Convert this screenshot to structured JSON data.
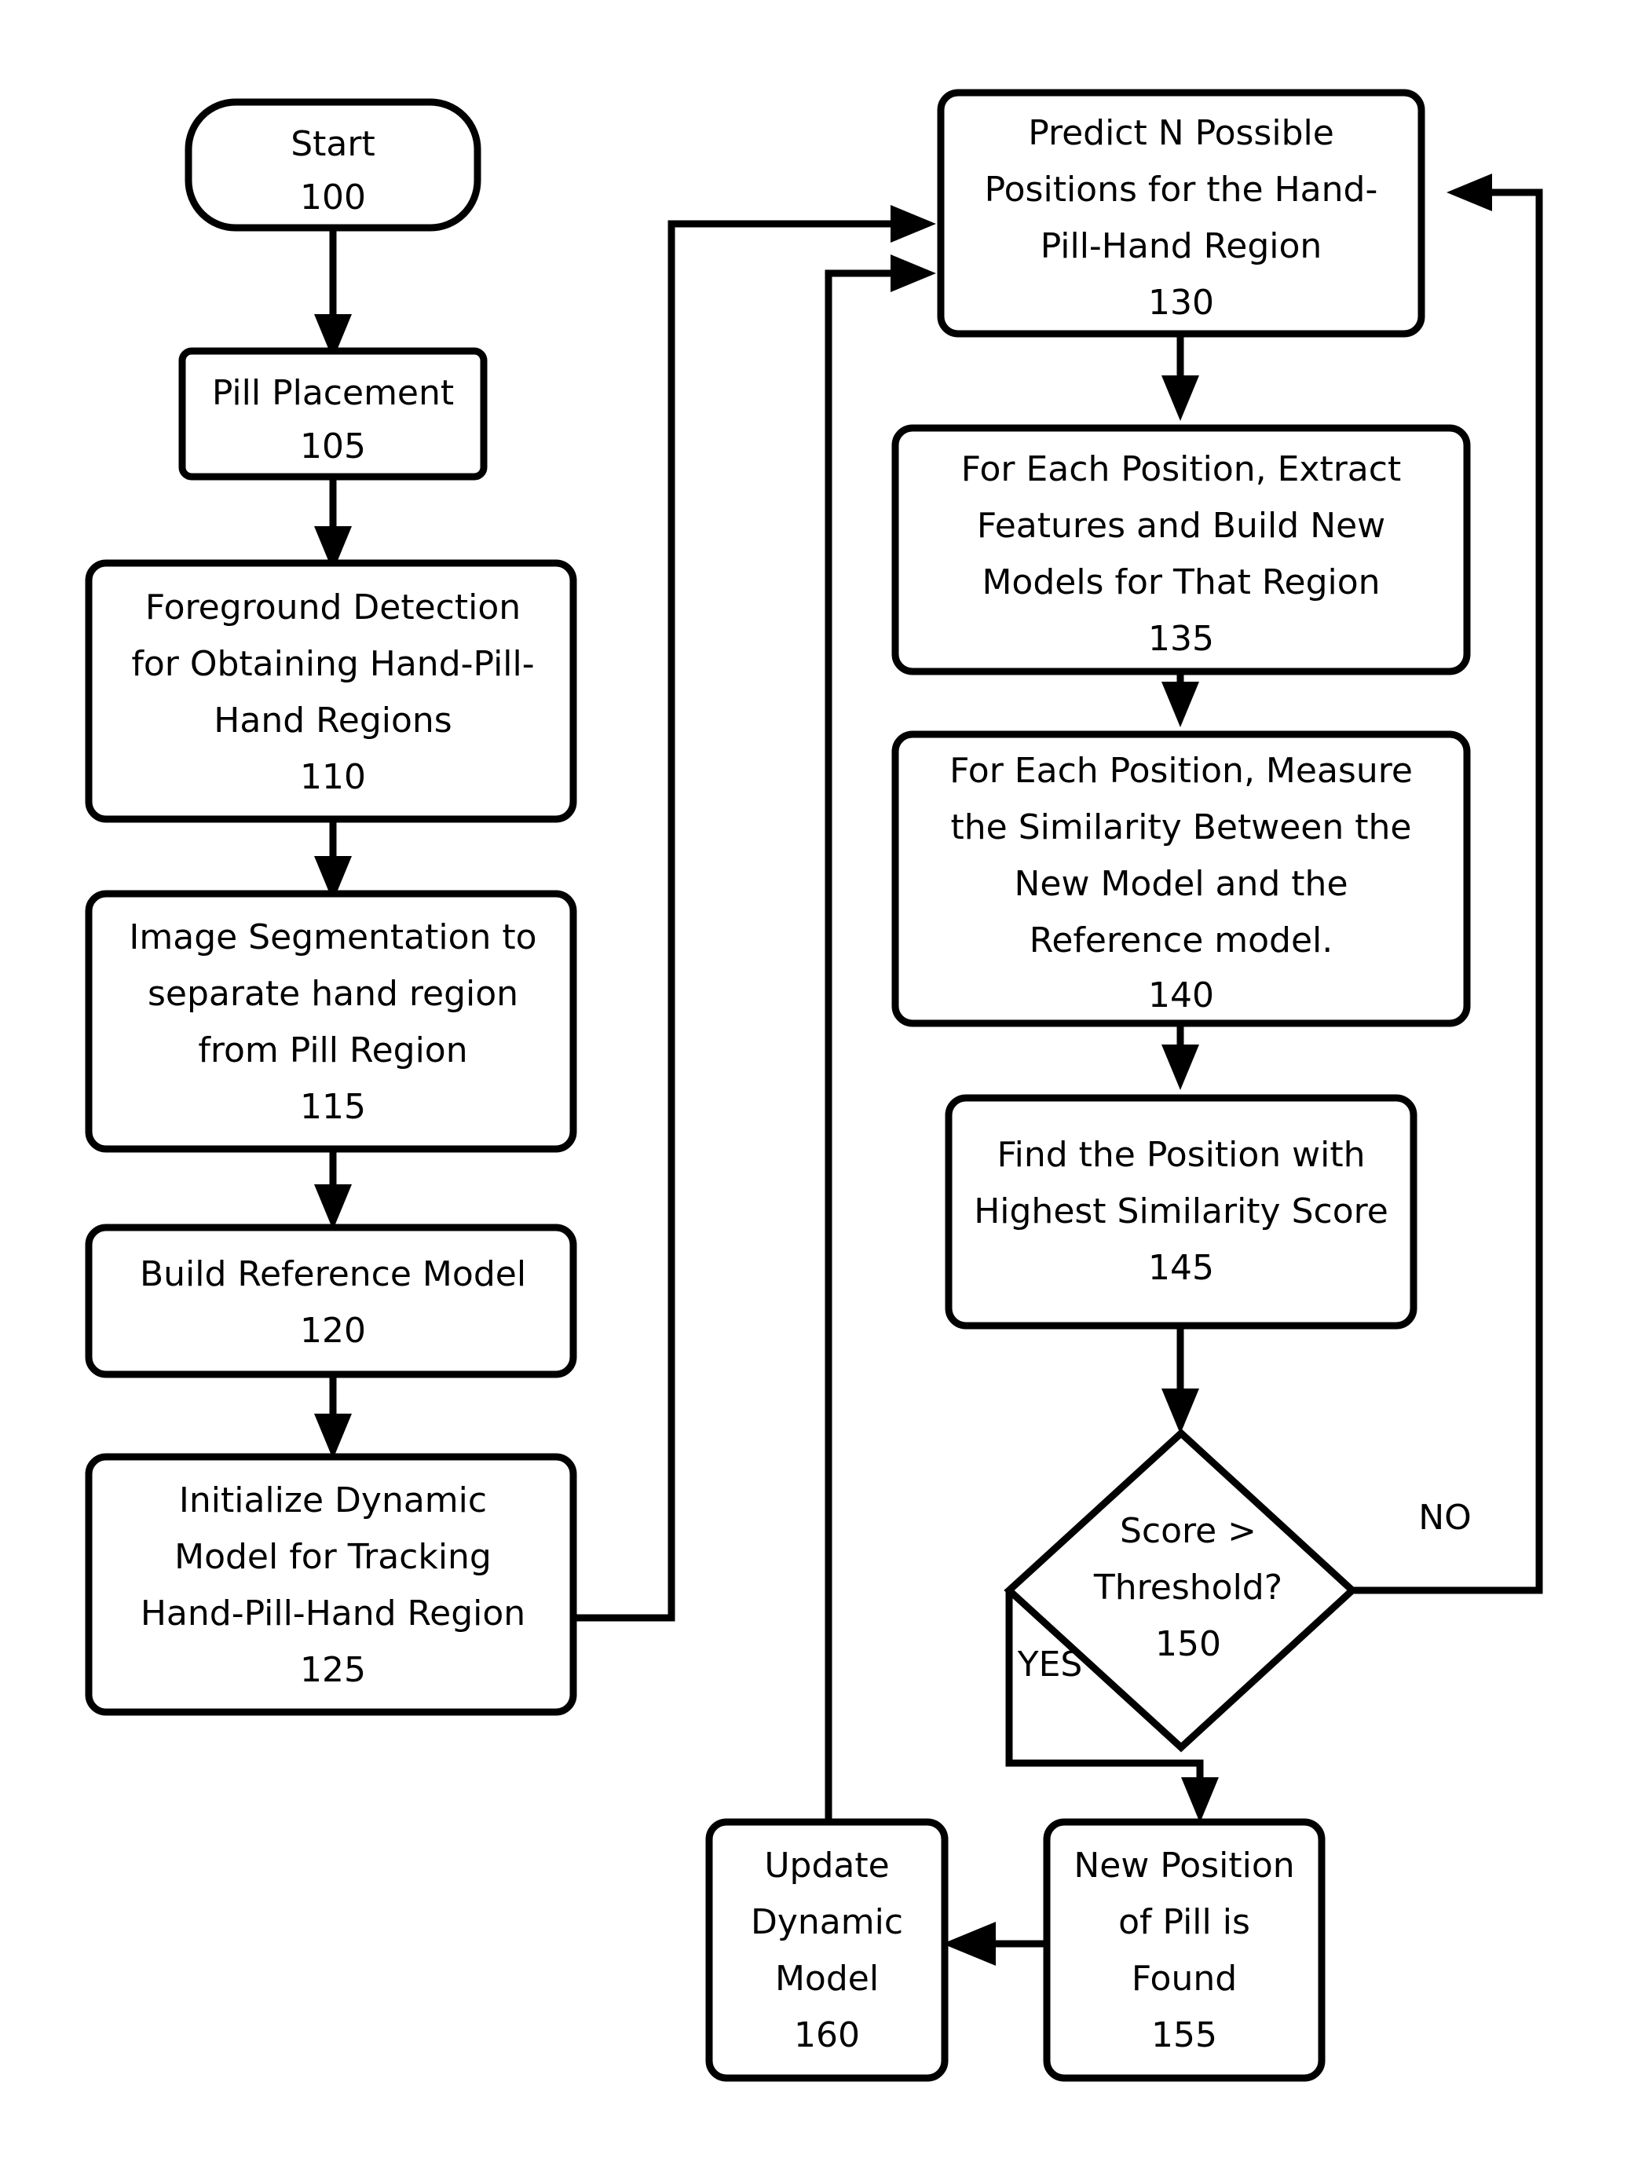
{
  "diagram": {
    "title": "Hand-Pill-Hand Region Tracking Flowchart",
    "stroke_color": "#000000",
    "fill_color": "#ffffff",
    "background_color": "#ffffff"
  },
  "nodes": {
    "start": {
      "id": "100",
      "shape": "terminal",
      "lines": [
        "Start",
        "100"
      ],
      "line1": "Start",
      "line2": "100"
    },
    "pill_placement": {
      "id": "105",
      "shape": "process",
      "line1": "Pill Placement",
      "line2": "105"
    },
    "foreground_detection": {
      "id": "110",
      "shape": "process",
      "line1": "Foreground Detection",
      "line2": "for Obtaining Hand-Pill-",
      "line3": "Hand Regions",
      "line4": "110"
    },
    "image_segmentation": {
      "id": "115",
      "shape": "process",
      "line1": "Image Segmentation to",
      "line2": "separate hand region",
      "line3": "from Pill Region",
      "line4": "115"
    },
    "build_reference_model": {
      "id": "120",
      "shape": "process",
      "line1": "Build Reference Model",
      "line2": "120"
    },
    "initialize_dynamic_model": {
      "id": "125",
      "shape": "process",
      "line1": "Initialize Dynamic",
      "line2": "Model for Tracking",
      "line3": "Hand-Pill-Hand Region",
      "line4": "125"
    },
    "predict_positions": {
      "id": "130",
      "shape": "process",
      "line1": "Predict N Possible",
      "line2": "Positions for the Hand-",
      "line3": "Pill-Hand Region",
      "line4": "130"
    },
    "extract_features": {
      "id": "135",
      "shape": "process",
      "line1": "For Each Position, Extract",
      "line2": "Features and Build New",
      "line3": "Models for That Region",
      "line4": "135"
    },
    "measure_similarity": {
      "id": "140",
      "shape": "process",
      "line1": "For Each Position, Measure",
      "line2": "the Similarity Between the",
      "line3": "New Model and the",
      "line4": "Reference model.",
      "line5": "140"
    },
    "find_highest_score": {
      "id": "145",
      "shape": "process",
      "line1": "Find the Position with",
      "line2": "Highest Similarity Score",
      "line3": "145"
    },
    "score_threshold": {
      "id": "150",
      "shape": "decision",
      "line1": "Score >",
      "line2": "Threshold?",
      "line3": "150"
    },
    "new_position_found": {
      "id": "155",
      "shape": "process",
      "line1": "New Position",
      "line2": "of Pill is",
      "line3": "Found",
      "line4": "155"
    },
    "update_dynamic_model": {
      "id": "160",
      "shape": "process",
      "line1": "Update",
      "line2": "Dynamic",
      "line3": "Model",
      "line4": "160"
    }
  },
  "edge_labels": {
    "yes": "YES",
    "no": "NO"
  },
  "chart_data": {
    "type": "diagram",
    "title": "Hand-Pill-Hand Region Tracking Flowchart",
    "nodes": [
      {
        "ref": "100",
        "label": "Start",
        "shape": "terminal"
      },
      {
        "ref": "105",
        "label": "Pill Placement",
        "shape": "process"
      },
      {
        "ref": "110",
        "label": "Foreground Detection for Obtaining Hand-Pill-Hand Regions",
        "shape": "process"
      },
      {
        "ref": "115",
        "label": "Image Segmentation to separate hand region from Pill Region",
        "shape": "process"
      },
      {
        "ref": "120",
        "label": "Build Reference Model",
        "shape": "process"
      },
      {
        "ref": "125",
        "label": "Initialize Dynamic Model for Tracking Hand-Pill-Hand Region",
        "shape": "process"
      },
      {
        "ref": "130",
        "label": "Predict N Possible Positions for the Hand-Pill-Hand Region",
        "shape": "process"
      },
      {
        "ref": "135",
        "label": "For Each Position, Extract Features and Build New Models for That Region",
        "shape": "process"
      },
      {
        "ref": "140",
        "label": "For Each Position, Measure the Similarity Between the New Model and the Reference model.",
        "shape": "process"
      },
      {
        "ref": "145",
        "label": "Find the Position with Highest Similarity Score",
        "shape": "process"
      },
      {
        "ref": "150",
        "label": "Score > Threshold?",
        "shape": "decision"
      },
      {
        "ref": "155",
        "label": "New Position of Pill is Found",
        "shape": "process"
      },
      {
        "ref": "160",
        "label": "Update Dynamic Model",
        "shape": "process"
      }
    ],
    "edges": [
      {
        "from": "100",
        "to": "105",
        "label": ""
      },
      {
        "from": "105",
        "to": "110",
        "label": ""
      },
      {
        "from": "110",
        "to": "115",
        "label": ""
      },
      {
        "from": "115",
        "to": "120",
        "label": ""
      },
      {
        "from": "120",
        "to": "125",
        "label": ""
      },
      {
        "from": "125",
        "to": "130",
        "label": ""
      },
      {
        "from": "130",
        "to": "135",
        "label": ""
      },
      {
        "from": "135",
        "to": "140",
        "label": ""
      },
      {
        "from": "140",
        "to": "145",
        "label": ""
      },
      {
        "from": "145",
        "to": "150",
        "label": ""
      },
      {
        "from": "150",
        "to": "155",
        "label": "YES"
      },
      {
        "from": "150",
        "to": "130",
        "label": "NO"
      },
      {
        "from": "155",
        "to": "160",
        "label": ""
      },
      {
        "from": "160",
        "to": "130",
        "label": ""
      }
    ]
  }
}
